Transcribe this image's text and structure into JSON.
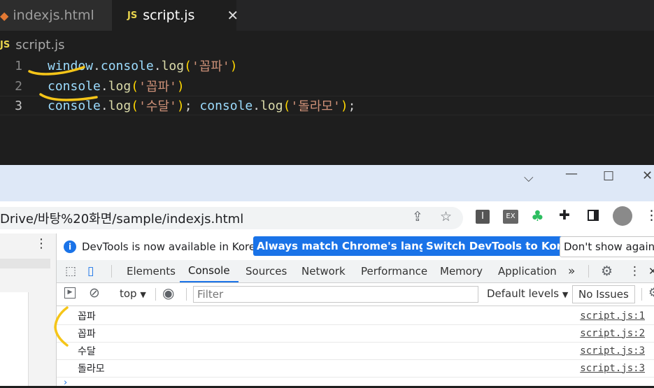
{
  "editor": {
    "tabs": [
      {
        "label": "indexjs.html"
      },
      {
        "label": "script.js",
        "badge": "JS"
      }
    ],
    "breadcrumb": {
      "badge": "JS",
      "label": "script.js"
    },
    "lines": [
      {
        "num": "1",
        "tokens": [
          "window",
          ".",
          "console",
          ".",
          "log",
          "(",
          "'꼽파'",
          ")"
        ]
      },
      {
        "num": "2",
        "tokens": [
          "console",
          ".",
          "log",
          "(",
          "'꼽파'",
          ")"
        ]
      },
      {
        "num": "3",
        "tokens": [
          "console",
          ".",
          "log",
          "(",
          "'수달'",
          ")",
          "; ",
          "console",
          ".",
          "log",
          "(",
          "'돌라모'",
          ")",
          ";"
        ]
      }
    ]
  },
  "browser": {
    "url": "Drive/바탕%20화면/sample/indexjs.html"
  },
  "devtools": {
    "info_text": "DevTools is now available in Korean!",
    "buttons": {
      "always_match": "Always match Chrome's language",
      "switch": "Switch DevTools to Korean",
      "dont_show": "Don't show again"
    },
    "tabs": [
      "Elements",
      "Console",
      "Sources",
      "Network",
      "Performance",
      "Memory",
      "Application"
    ],
    "more_tabs": "»",
    "console_toolbar": {
      "context": "top",
      "filter_placeholder": "Filter",
      "levels": "Default levels",
      "issues": "No Issues"
    },
    "logs": [
      {
        "message": "꼽파",
        "source": "script.js:1"
      },
      {
        "message": "꼽파",
        "source": "script.js:2"
      },
      {
        "message": "수달",
        "source": "script.js:3"
      },
      {
        "message": "돌라모",
        "source": "script.js:3"
      }
    ]
  },
  "colors": {
    "annotation": "#f5c518",
    "accent": "#1a73e8"
  }
}
